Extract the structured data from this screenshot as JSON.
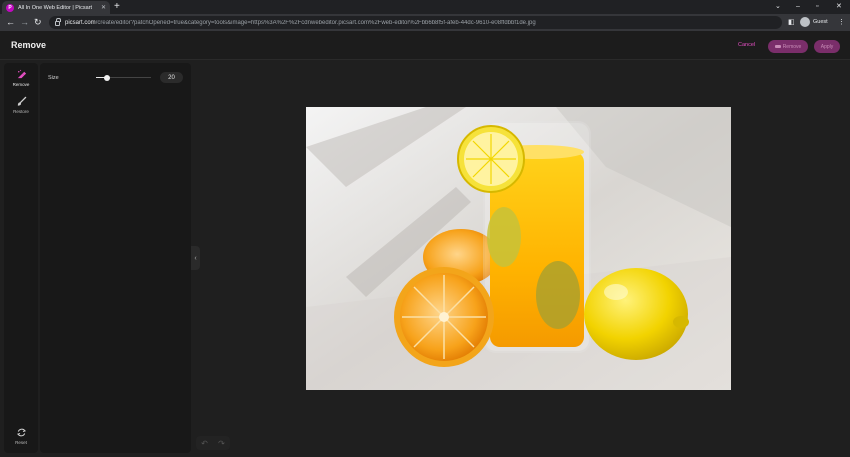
{
  "browser": {
    "tab_title": "All In One Web Editor | Picsart",
    "tab_favicon_letter": "P",
    "url_host": "picsart.com",
    "url_path": "/create/editor?patchOpened=true&category=tools&image=https%3A%2F%2Fcdnwebeditor.picsart.com%2Fweb-editor%2Fbb6b8f5f-afeb-44dc-9610-e08ffdbbf1de.jpg",
    "profile_label": "Guest"
  },
  "header": {
    "title": "Remove",
    "cancel_label": "Cancel",
    "remove_label": "Remove",
    "apply_label": "Apply",
    "accent_color": "#e44fc2"
  },
  "tools": [
    {
      "label": "Remove",
      "icon": "eraser-icon",
      "active": true
    },
    {
      "label": "Restore",
      "icon": "brush-icon",
      "active": false
    },
    {
      "label": "Reset",
      "icon": "reset-icon",
      "active": false
    }
  ],
  "settings": {
    "size_label": "Size",
    "size_value": "20",
    "size_fraction": 0.2
  },
  "canvas": {
    "image_subject": "photo"
  }
}
